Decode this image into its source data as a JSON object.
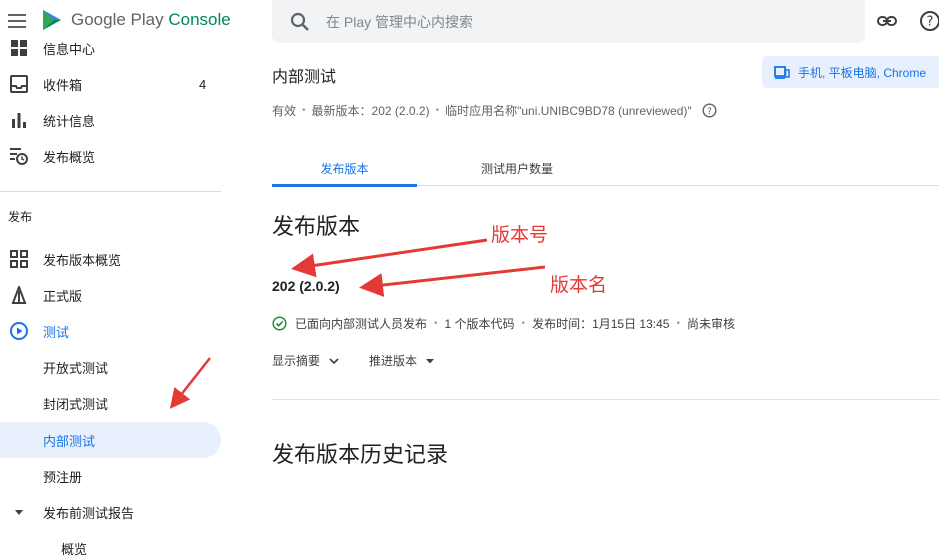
{
  "header": {
    "logo_text_1": "Google Play",
    "logo_text_2": "Console",
    "search_placeholder": "在 Play 管理中心内搜索"
  },
  "sidebar": {
    "items": [
      {
        "label": "信息中心",
        "icon": "dashboard-icon"
      },
      {
        "label": "收件箱",
        "icon": "inbox-icon",
        "count": "4"
      },
      {
        "label": "统计信息",
        "icon": "bar-chart-icon"
      },
      {
        "label": "发布概览",
        "icon": "publishing-overview-icon"
      }
    ],
    "section_title": "发布",
    "release_items": [
      {
        "label": "发布版本概览",
        "icon": "release-overview-icon"
      },
      {
        "label": "正式版",
        "icon": "production-icon"
      },
      {
        "label": "测试",
        "icon": "testing-icon"
      },
      {
        "label": "开放式测试"
      },
      {
        "label": "封闭式测试"
      },
      {
        "label": "内部测试"
      },
      {
        "label": "预注册"
      },
      {
        "label": "发布前测试报告",
        "icon": "expand-arrow-icon"
      },
      {
        "label": "概览"
      }
    ]
  },
  "main": {
    "page_title": "内部测试",
    "device_button": "手机, 平板电脑, Chrome",
    "status": {
      "state": "有效",
      "latest": "最新版本：202 (2.0.2)",
      "temp_name": "临时应用名称\"uni.UNIBC9BD78 (unreviewed)\""
    },
    "tabs": [
      {
        "label": "发布版本"
      },
      {
        "label": "测试用户数量"
      }
    ],
    "section_release": "发布版本",
    "version": "202 (2.0.2)",
    "release_meta": {
      "published": "已面向内部测试人员发布",
      "codes": "1 个版本代码",
      "time": "发布时间：1月15日 13:45",
      "review": "尚未审核"
    },
    "actions": {
      "summary": "显示摘要",
      "promote": "推进版本"
    },
    "section_history": "发布版本历史记录"
  },
  "annotations": {
    "version_code": "版本号",
    "version_name": "版本名"
  },
  "colors": {
    "accent": "#1a73e8",
    "brand_green": "#01875f",
    "annotation_red": "#e53935",
    "success_green": "#1e8e3e"
  }
}
